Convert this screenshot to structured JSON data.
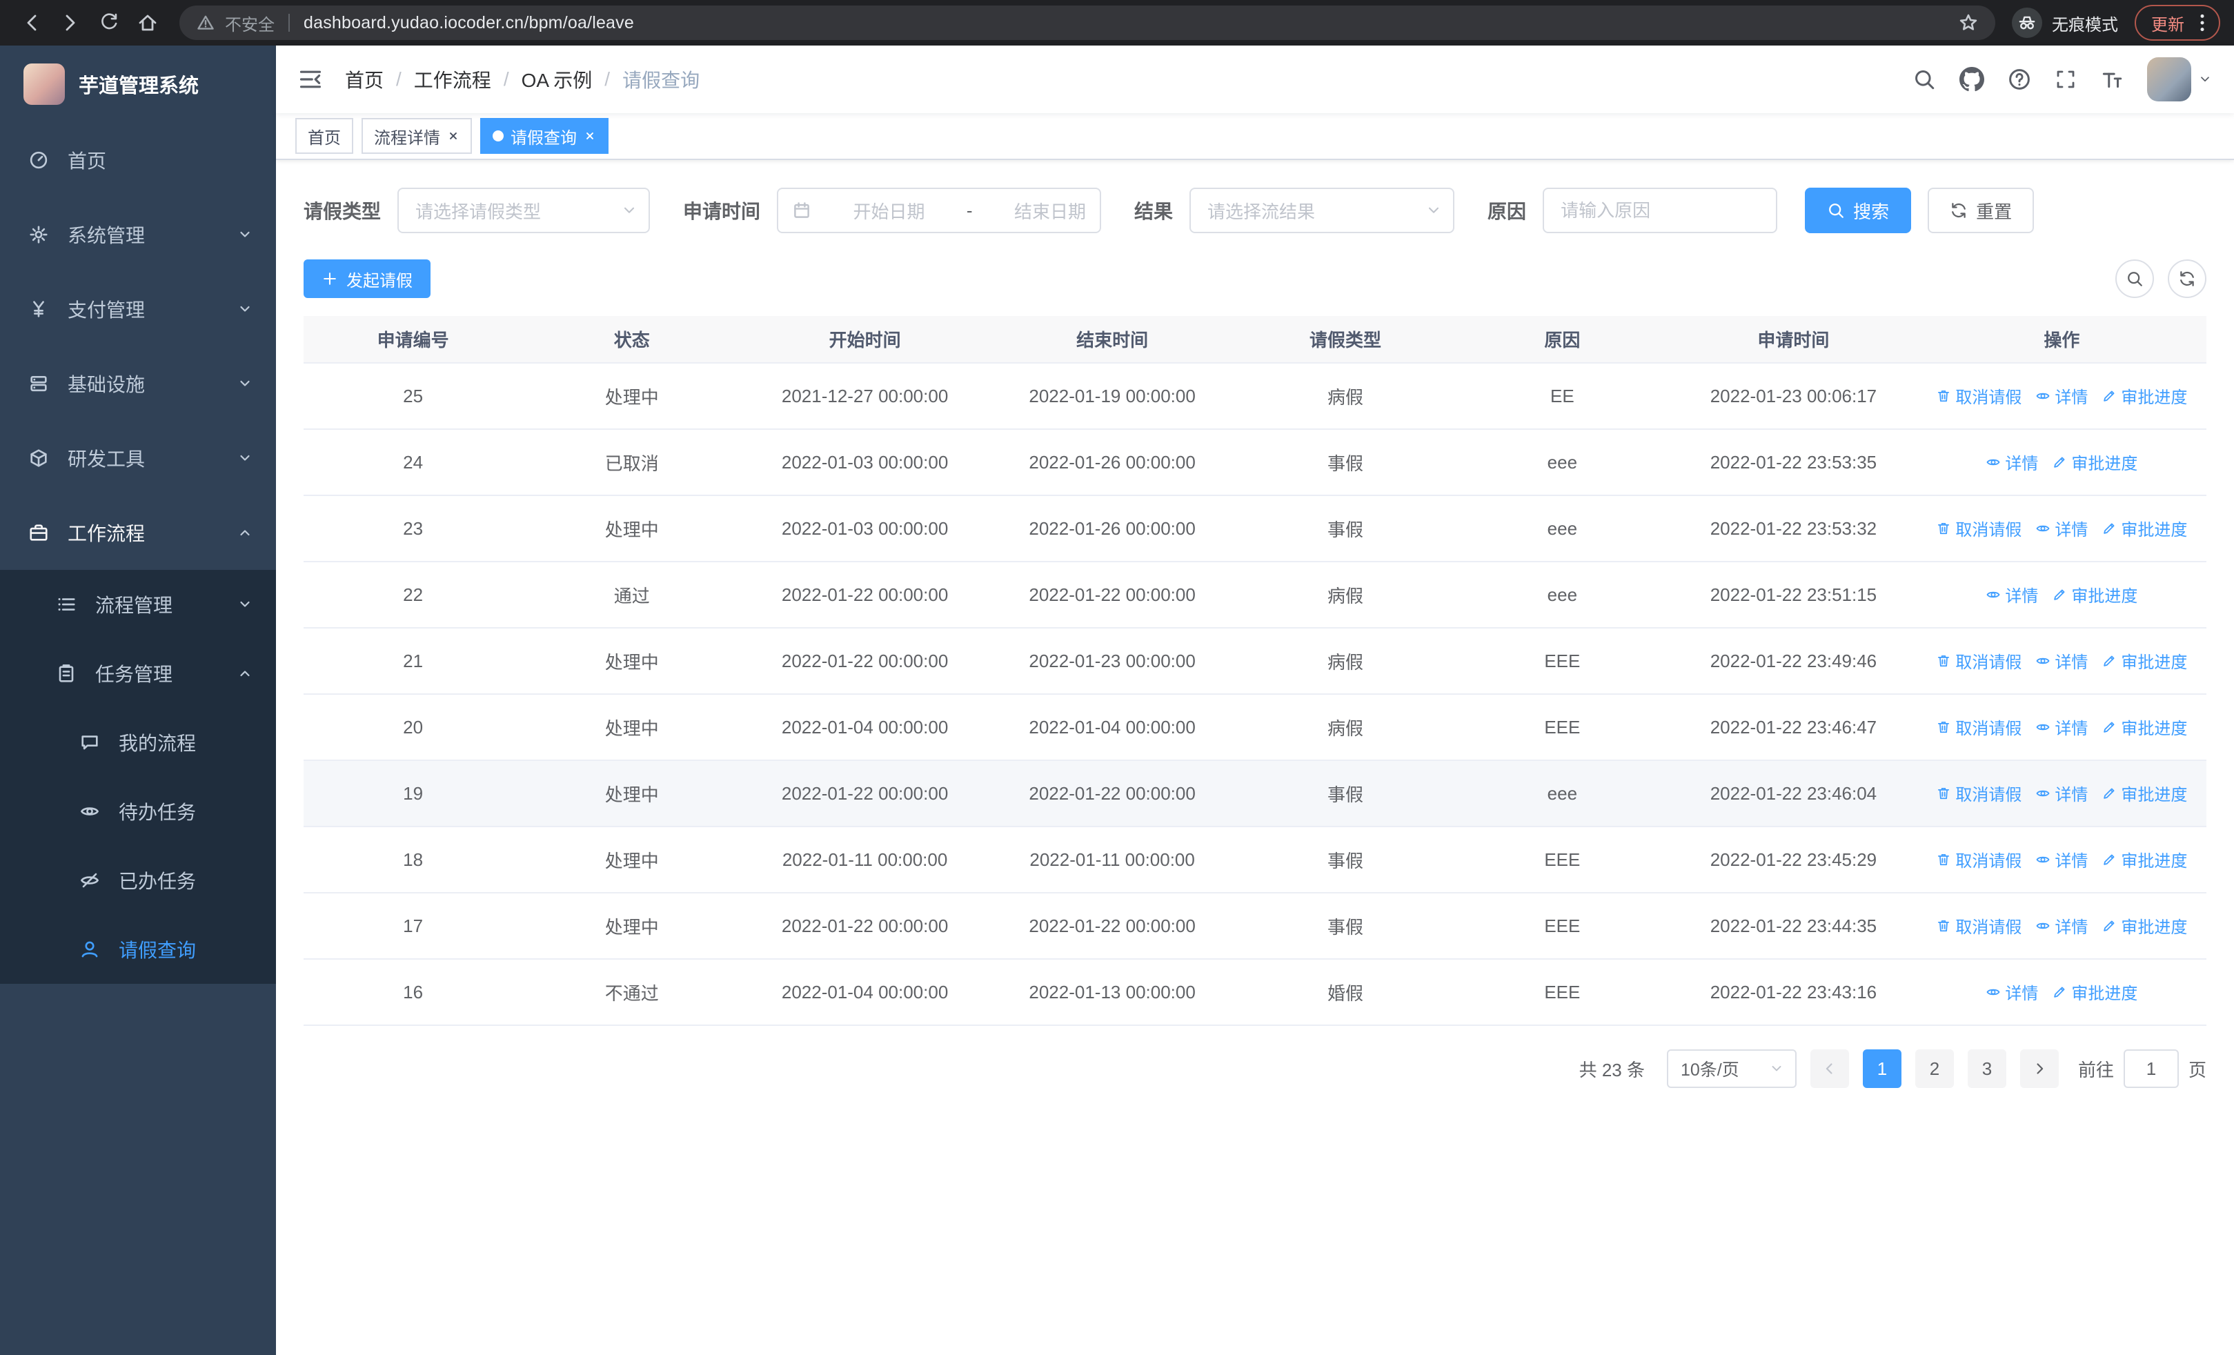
{
  "colors": {
    "accent": "#409eff",
    "sidebar_bg": "#304156",
    "submenu_bg": "#1f2d3d"
  },
  "browser": {
    "security_label": "不安全",
    "url": "dashboard.yudao.iocoder.cn/bpm/oa/leave",
    "incognito_label": "无痕模式",
    "update_label": "更新"
  },
  "sidebar": {
    "logo_title": "芋道管理系统",
    "menu": [
      {
        "label": "首页",
        "icon": "dashboard-icon",
        "level": 1
      },
      {
        "label": "系统管理",
        "icon": "gear-icon",
        "level": 1,
        "arrow": "down"
      },
      {
        "label": "支付管理",
        "icon": "yen-icon",
        "level": 1,
        "arrow": "down"
      },
      {
        "label": "基础设施",
        "icon": "server-icon",
        "level": 1,
        "arrow": "down"
      },
      {
        "label": "研发工具",
        "icon": "cube-icon",
        "level": 1,
        "arrow": "down"
      },
      {
        "label": "工作流程",
        "icon": "briefcase-icon",
        "level": 1,
        "arrow": "up",
        "open": true
      },
      {
        "label": "流程管理",
        "icon": "list-icon",
        "level": 2,
        "arrow": "down"
      },
      {
        "label": "任务管理",
        "icon": "clipboard-icon",
        "level": 2,
        "arrow": "up"
      },
      {
        "label": "我的流程",
        "icon": "chat-icon",
        "level": 3
      },
      {
        "label": "待办任务",
        "icon": "eye-icon",
        "level": 3
      },
      {
        "label": "已办任务",
        "icon": "eye-off-icon",
        "level": 3
      },
      {
        "label": "请假查询",
        "icon": "user-icon",
        "level": 3,
        "active": true
      }
    ]
  },
  "header": {
    "breadcrumb": [
      "首页",
      "工作流程",
      "OA 示例",
      "请假查询"
    ]
  },
  "tabs": [
    {
      "label": "首页"
    },
    {
      "label": "流程详情",
      "closable": true
    },
    {
      "label": "请假查询",
      "closable": true,
      "active": true
    }
  ],
  "filters": {
    "leave_type_label": "请假类型",
    "leave_type_placeholder": "请选择请假类型",
    "apply_time_label": "申请时间",
    "start_date_placeholder": "开始日期",
    "range_separator": "-",
    "end_date_placeholder": "结束日期",
    "result_label": "结果",
    "result_placeholder": "请选择流结果",
    "reason_label": "原因",
    "reason_placeholder": "请输入原因",
    "search_label": "搜索",
    "reset_label": "重置"
  },
  "toolbar": {
    "create_label": "发起请假"
  },
  "table": {
    "columns": [
      "申请编号",
      "状态",
      "开始时间",
      "结束时间",
      "请假类型",
      "原因",
      "申请时间",
      "操作"
    ],
    "action_labels": {
      "cancel": "取消请假",
      "detail": "详情",
      "progress": "审批进度"
    },
    "rows": [
      {
        "id": "25",
        "status": "处理中",
        "start_time": "2021-12-27 00:00:00",
        "end_time": "2022-01-19 00:00:00",
        "leave_type": "病假",
        "reason": "EE",
        "apply_time": "2022-01-23 00:06:17",
        "actions": [
          "cancel",
          "detail",
          "progress"
        ]
      },
      {
        "id": "24",
        "status": "已取消",
        "start_time": "2022-01-03 00:00:00",
        "end_time": "2022-01-26 00:00:00",
        "leave_type": "事假",
        "reason": "eee",
        "apply_time": "2022-01-22 23:53:35",
        "actions": [
          "detail",
          "progress"
        ]
      },
      {
        "id": "23",
        "status": "处理中",
        "start_time": "2022-01-03 00:00:00",
        "end_time": "2022-01-26 00:00:00",
        "leave_type": "事假",
        "reason": "eee",
        "apply_time": "2022-01-22 23:53:32",
        "actions": [
          "cancel",
          "detail",
          "progress"
        ]
      },
      {
        "id": "22",
        "status": "通过",
        "start_time": "2022-01-22 00:00:00",
        "end_time": "2022-01-22 00:00:00",
        "leave_type": "病假",
        "reason": "eee",
        "apply_time": "2022-01-22 23:51:15",
        "actions": [
          "detail",
          "progress"
        ]
      },
      {
        "id": "21",
        "status": "处理中",
        "start_time": "2022-01-22 00:00:00",
        "end_time": "2022-01-23 00:00:00",
        "leave_type": "病假",
        "reason": "EEE",
        "apply_time": "2022-01-22 23:49:46",
        "actions": [
          "cancel",
          "detail",
          "progress"
        ]
      },
      {
        "id": "20",
        "status": "处理中",
        "start_time": "2022-01-04 00:00:00",
        "end_time": "2022-01-04 00:00:00",
        "leave_type": "病假",
        "reason": "EEE",
        "apply_time": "2022-01-22 23:46:47",
        "actions": [
          "cancel",
          "detail",
          "progress"
        ]
      },
      {
        "id": "19",
        "status": "处理中",
        "start_time": "2022-01-22 00:00:00",
        "end_time": "2022-01-22 00:00:00",
        "leave_type": "事假",
        "reason": "eee",
        "apply_time": "2022-01-22 23:46:04",
        "actions": [
          "cancel",
          "detail",
          "progress"
        ],
        "hovered": true
      },
      {
        "id": "18",
        "status": "处理中",
        "start_time": "2022-01-11 00:00:00",
        "end_time": "2022-01-11 00:00:00",
        "leave_type": "事假",
        "reason": "EEE",
        "apply_time": "2022-01-22 23:45:29",
        "actions": [
          "cancel",
          "detail",
          "progress"
        ]
      },
      {
        "id": "17",
        "status": "处理中",
        "start_time": "2022-01-22 00:00:00",
        "end_time": "2022-01-22 00:00:00",
        "leave_type": "事假",
        "reason": "EEE",
        "apply_time": "2022-01-22 23:44:35",
        "actions": [
          "cancel",
          "detail",
          "progress"
        ]
      },
      {
        "id": "16",
        "status": "不通过",
        "start_time": "2022-01-04 00:00:00",
        "end_time": "2022-01-13 00:00:00",
        "leave_type": "婚假",
        "reason": "EEE",
        "apply_time": "2022-01-22 23:43:16",
        "actions": [
          "detail",
          "progress"
        ]
      }
    ]
  },
  "pagination": {
    "total_label": "共 23 条",
    "page_size_label": "10条/页",
    "pages": [
      "1",
      "2",
      "3"
    ],
    "active_page": "1",
    "goto_prefix": "前往",
    "goto_value": "1",
    "goto_suffix": "页"
  }
}
